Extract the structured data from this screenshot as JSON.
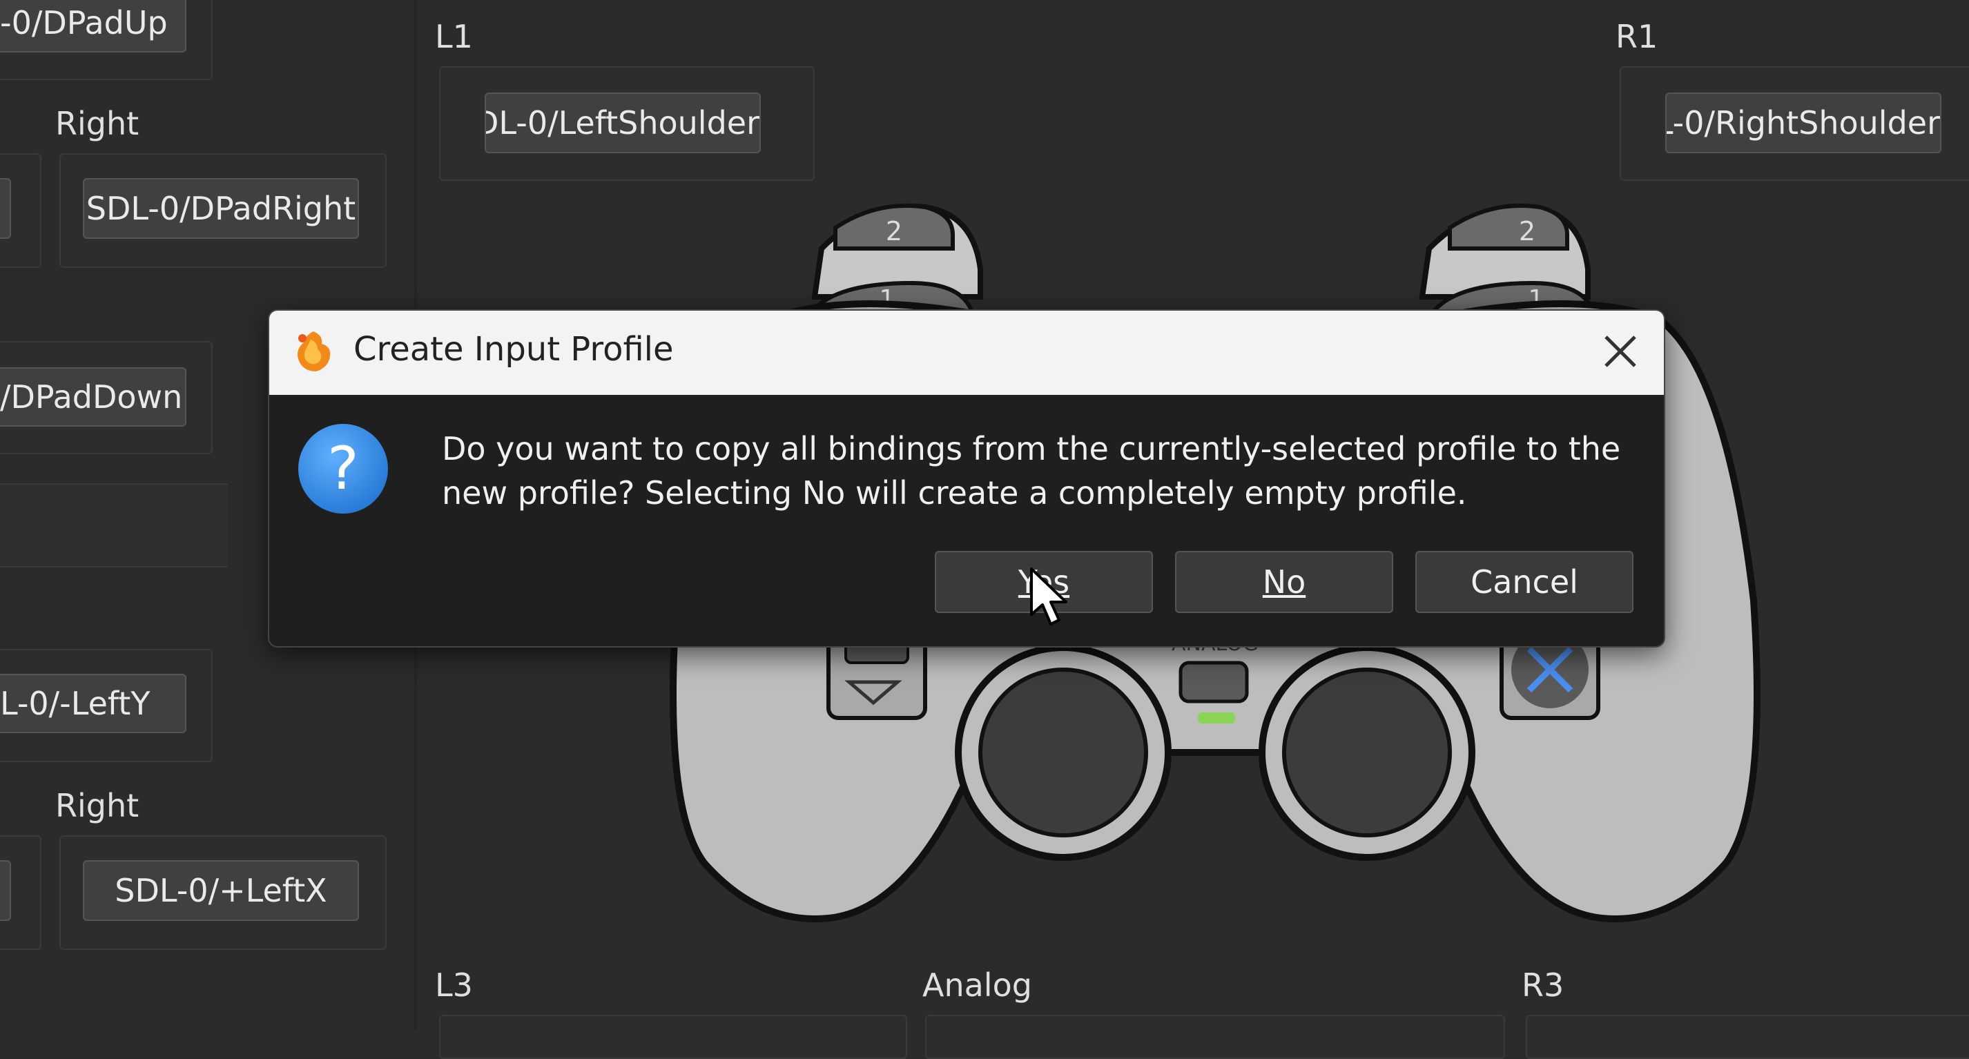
{
  "left_panel": {
    "dpad_up_binding": "-0/DPadUp",
    "right_label_1": "Right",
    "dpad_right_binding": "SDL-0/DPadRight",
    "dpad_down_binding": "/DPadDown",
    "left_y_binding": "L-0/-LeftY",
    "right_label_2": "Right",
    "left_x_binding": "SDL-0/+LeftX"
  },
  "shoulders": {
    "l1_label": "L1",
    "l1_binding": "SDL-0/LeftShoulder",
    "r1_label": "R1",
    "r1_binding": "SDL-0/RightShoulder"
  },
  "bottom_labels": {
    "l3": "L3",
    "analog": "Analog",
    "r3": "R3"
  },
  "controller": {
    "l2_mark": "2",
    "l1_mark": "1",
    "r2_mark": "2",
    "r1_mark": "1",
    "analog_text": "ANALOG"
  },
  "dialog": {
    "title": "Create Input Profile",
    "message": "Do you want to copy all bindings from the currently-selected profile to the new profile? Selecting No will create a completely empty profile.",
    "icon_symbol": "?",
    "yes_label": "Yes",
    "no_label": "No",
    "cancel_label": "Cancel"
  }
}
